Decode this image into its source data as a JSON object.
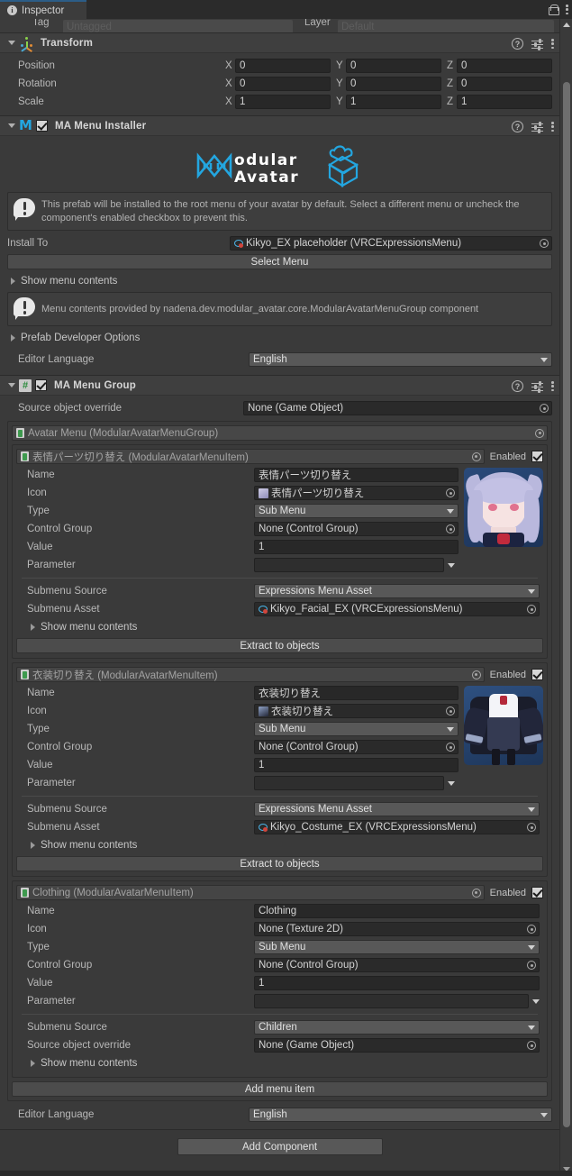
{
  "window": {
    "tab_label": "Inspector",
    "tab_icon": "info-icon",
    "lock_icon": "lock-icon",
    "menu_icon": "kebab-menu-icon"
  },
  "tag_row": {
    "tag_label": "Tag",
    "tag_value": "Untagged",
    "layer_label": "Layer",
    "layer_value": "Default"
  },
  "transform": {
    "title": "Transform",
    "icon": "transform-gizmo-icon",
    "rows": [
      {
        "label": "Position",
        "x": "0",
        "y": "0",
        "z": "0"
      },
      {
        "label": "Rotation",
        "x": "0",
        "y": "0",
        "z": "0"
      },
      {
        "label": "Scale",
        "x": "1",
        "y": "1",
        "z": "1"
      }
    ],
    "axis": {
      "x": "X",
      "y": "Y",
      "z": "Z"
    }
  },
  "menu_installer": {
    "title": "MA Menu Installer",
    "icon": "modular-avatar-m-icon",
    "enabled": true,
    "logo": {
      "line1": "odular",
      "line2": "Avatar"
    },
    "help": "This prefab will be installed to the root menu of your avatar by default. Select a different menu or uncheck the component's enabled checkbox to prevent this.",
    "install_to_label": "Install To",
    "install_to_value": "Kikyo_EX placeholder (VRCExpressionsMenu)",
    "select_menu_button": "Select Menu",
    "show_menu_contents": "Show menu contents",
    "menu_contents_help": "Menu contents provided by nadena.dev.modular_avatar.core.ModularAvatarMenuGroup component",
    "prefab_dev_options": "Prefab Developer Options",
    "editor_language_label": "Editor Language",
    "editor_language_value": "English"
  },
  "menu_group": {
    "title": "MA Menu Group",
    "icon": "script-hash-icon",
    "enabled": true,
    "source_object_override_label": "Source object override",
    "source_object_override_value": "None (Game Object)",
    "group_header": "Avatar Menu (ModularAvatarMenuGroup)",
    "add_menu_item_button": "Add menu item",
    "editor_language_label": "Editor Language",
    "editor_language_value": "English",
    "labels": {
      "name": "Name",
      "icon": "Icon",
      "type": "Type",
      "control_group": "Control Group",
      "value": "Value",
      "parameter": "Parameter",
      "submenu_source": "Submenu Source",
      "submenu_asset": "Submenu Asset",
      "source_object_override": "Source object override",
      "show_menu_contents": "Show menu contents",
      "extract_to_objects": "Extract to objects",
      "enabled": "Enabled"
    },
    "items": [
      {
        "header": "表情パーツ切り替え (ModularAvatarMenuItem)",
        "enabled": true,
        "name": "表情パーツ切り替え",
        "icon_value": "表情パーツ切り替え",
        "icon_kind": "face-texture-icon",
        "type": "Sub Menu",
        "control_group": "None (Control Group)",
        "value": "1",
        "parameter": "",
        "submenu_source": "Expressions Menu Asset",
        "submenu_asset": "Kikyo_Facial_EX (VRCExpressionsMenu)",
        "show_menu_contents": "Show menu contents",
        "extract_button": "Extract to objects",
        "thumbnail": "avatar-face-thumbnail"
      },
      {
        "header": "衣装切り替え (ModularAvatarMenuItem)",
        "enabled": true,
        "name": "衣装切り替え",
        "icon_value": "衣装切り替え",
        "icon_kind": "costume-texture-icon",
        "type": "Sub Menu",
        "control_group": "None (Control Group)",
        "value": "1",
        "parameter": "",
        "submenu_source": "Expressions Menu Asset",
        "submenu_asset": "Kikyo_Costume_EX (VRCExpressionsMenu)",
        "show_menu_contents": "Show menu contents",
        "extract_button": "Extract to objects",
        "thumbnail": "costume-thumbnail"
      },
      {
        "header": "Clothing (ModularAvatarMenuItem)",
        "enabled": true,
        "name": "Clothing",
        "icon_value": "None (Texture 2D)",
        "icon_kind": "none",
        "type": "Sub Menu",
        "control_group": "None (Control Group)",
        "value": "1",
        "parameter": "",
        "submenu_source": "Children",
        "source_object_override": "None (Game Object)",
        "show_menu_contents": "Show menu contents",
        "thumbnail": "none"
      }
    ]
  },
  "footer": {
    "add_component_button": "Add Component"
  },
  "colors": {
    "accent": "#23a6e0",
    "panel": "#383838",
    "header": "#3f3f3f",
    "field": "#282828",
    "popup": "#585858",
    "tab_active_border": "#2c5d87"
  }
}
